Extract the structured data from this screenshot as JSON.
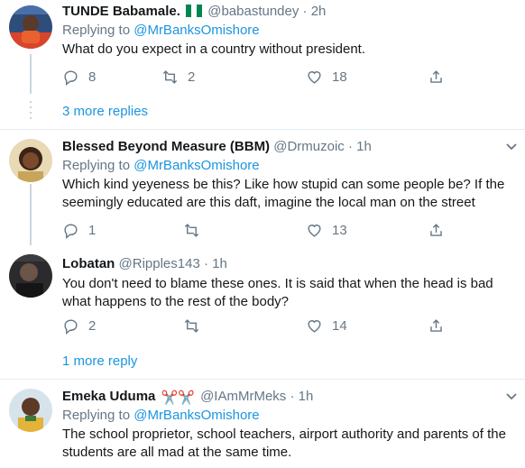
{
  "tweets": [
    {
      "name": "TUNDE Babamale.",
      "handle": "@babastundey",
      "time": "· 2h",
      "reply_prefix": "Replying to",
      "reply_to": "@MrBanksOmishore",
      "text": "What do you expect in a country without president.",
      "replies": "8",
      "retweets": "2",
      "likes": "18"
    },
    {
      "name": "Blessed Beyond Measure (BBM)",
      "handle": "@Drmuzoic",
      "time": "· 1h",
      "reply_prefix": "Replying to",
      "reply_to": "@MrBanksOmishore",
      "text": "Which kind yeyeness be this? Like how stupid can some people be? If the seemingly educated are this daft, imagine the local man on the street",
      "replies": "1",
      "retweets": "",
      "likes": "13"
    },
    {
      "name": "Lobatan",
      "handle": "@Ripples143",
      "time": "· 1h",
      "text": "You don't need to blame these ones. It is said that when the head is bad what happens to the rest of the body?",
      "replies": "2",
      "retweets": "",
      "likes": "14"
    },
    {
      "name": "Emeka Uduma",
      "emoji": "✂️✂️",
      "handle": "@IAmMrMeks",
      "time": "· 1h",
      "reply_prefix": "Replying to",
      "reply_to": "@MrBanksOmishore",
      "text": "The school proprietor, school teachers, airport authority and parents of the students are all mad at the same time."
    }
  ],
  "more_replies": [
    "3 more replies",
    "1 more reply"
  ],
  "icons": {
    "reply": "reply-icon",
    "retweet": "retweet-icon",
    "like": "heart-icon",
    "share": "share-icon",
    "caret": "chevron-down-icon",
    "flag": "nigeria-flag-icon"
  },
  "colors": {
    "link": "#1b95e0",
    "secondary": "#657786",
    "divider": "#e6ecf0",
    "thread_line": "#ccd6dd",
    "flag_green": "#008751"
  }
}
